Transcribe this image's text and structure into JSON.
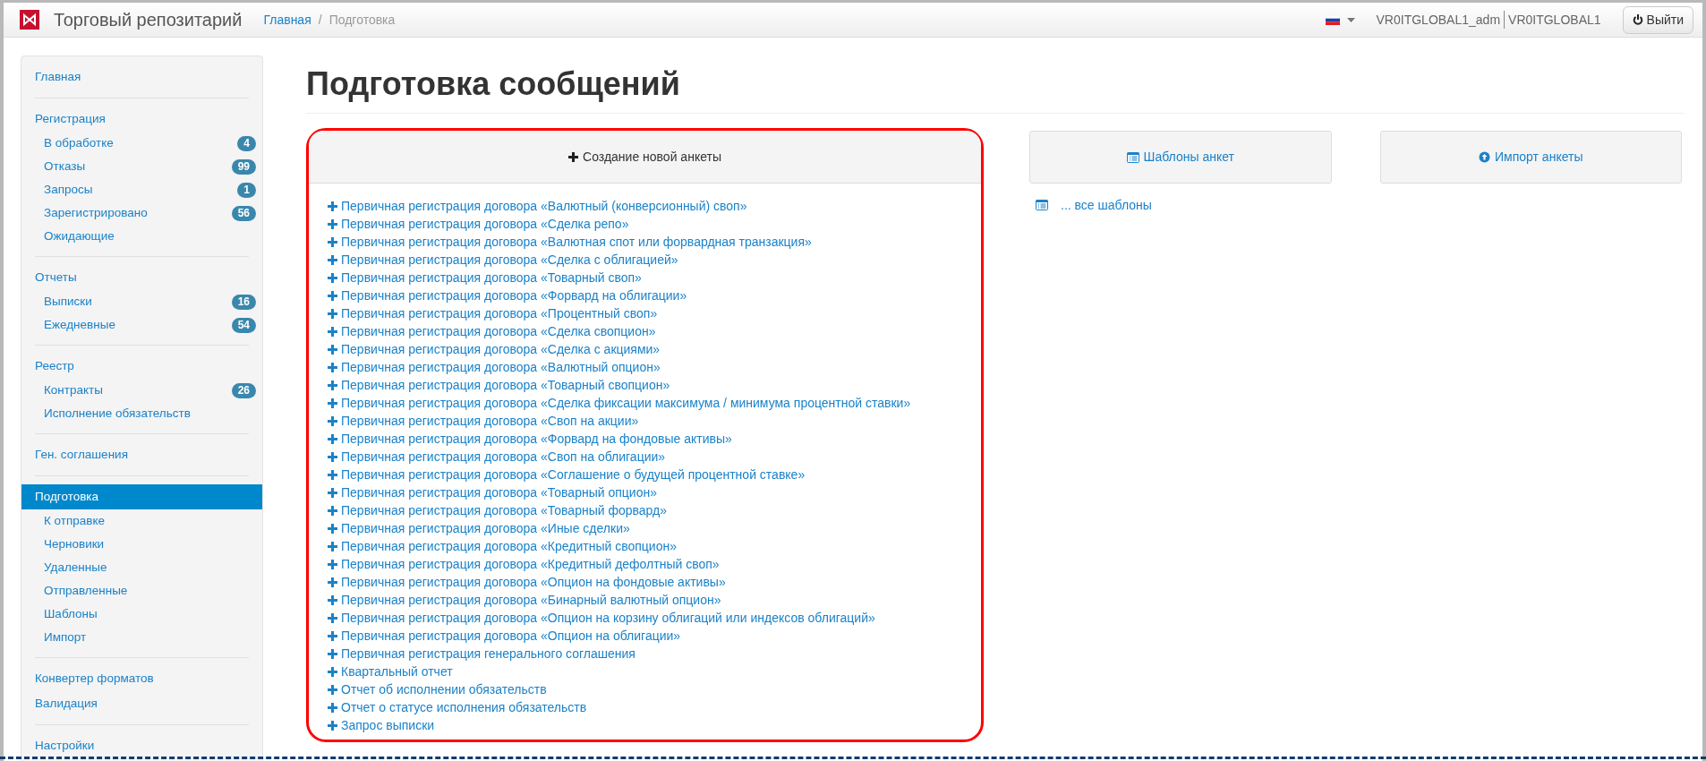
{
  "header": {
    "title": "Торговый репозитарий",
    "breadcrumb_separator": "/",
    "breadcrumb": [
      {
        "label": "Главная",
        "selected": false
      },
      {
        "label": "Подготовка",
        "selected": true
      }
    ],
    "user": "VR0ITGLOBAL1_adm",
    "organization": "VR0ITGLOBAL1",
    "logout": "Выйти"
  },
  "sidebar": {
    "groups": [
      {
        "sections": [
          {
            "label": "Главная",
            "selected": false
          }
        ]
      },
      {
        "sections": [
          {
            "label": "Регистрация",
            "selected": false,
            "children": [
              {
                "label": "В обработке",
                "badge": "4",
                "selected": false
              },
              {
                "label": "Отказы",
                "badge": "99",
                "selected": false
              },
              {
                "label": "Запросы",
                "badge": "1",
                "selected": false
              },
              {
                "label": "Зарегистрировано",
                "badge": "56",
                "selected": false
              },
              {
                "label": "Ожидающие",
                "selected": false
              }
            ]
          }
        ]
      },
      {
        "sections": [
          {
            "label": "Отчеты",
            "selected": false,
            "children": [
              {
                "label": "Выписки",
                "badge": "16",
                "selected": false
              },
              {
                "label": "Ежедневные",
                "badge": "54",
                "selected": false
              }
            ]
          }
        ]
      },
      {
        "sections": [
          {
            "label": "Реестр",
            "selected": false,
            "children": [
              {
                "label": "Контракты",
                "badge": "26",
                "selected": false
              },
              {
                "label": "Исполнение обязательств",
                "selected": false
              }
            ]
          }
        ]
      },
      {
        "sections": [
          {
            "label": "Ген. соглашения",
            "selected": false
          }
        ]
      },
      {
        "sections": [
          {
            "label": "Подготовка",
            "selected": true,
            "children": [
              {
                "label": "К отправке",
                "selected": false
              },
              {
                "label": "Черновики",
                "selected": false
              },
              {
                "label": "Удаленные",
                "selected": false
              },
              {
                "label": "Отправленные",
                "selected": false
              },
              {
                "label": "Шаблоны",
                "selected": false
              },
              {
                "label": "Импорт",
                "selected": false
              }
            ]
          }
        ]
      },
      {
        "sections": [
          {
            "label": "Конвертер форматов",
            "selected": false
          },
          {
            "label": "Валидация",
            "selected": false
          }
        ]
      },
      {
        "sections": [
          {
            "label": "Настройки",
            "selected": false
          }
        ]
      }
    ]
  },
  "page_title": "Подготовка сообщений",
  "panels": [
    {
      "kind": "create",
      "title": "Создание новой анкеты",
      "highlighted": true,
      "items": [
        "Первичная регистрация договора «Валютный (конверсионный) своп»",
        "Первичная регистрация договора «Сделка репо»",
        "Первичная регистрация договора «Валютная спот или форвардная транзакция»",
        "Первичная регистрация договора «Сделка с облигацией»",
        "Первичная регистрация договора «Товарный своп»",
        "Первичная регистрация договора «Форвард на облигации»",
        "Первичная регистрация договора «Процентный своп»",
        "Первичная регистрация договора «Сделка свопцион»",
        "Первичная регистрация договора «Сделка с акциями»",
        "Первичная регистрация договора «Валютный опцион»",
        "Первичная регистрация договора «Товарный свопцион»",
        "Первичная регистрация договора «Сделка фиксации максимума / минимума процентной ставки»",
        "Первичная регистрация договора «Своп на акции»",
        "Первичная регистрация договора «Форвард на фондовые активы»",
        "Первичная регистрация договора «Своп на облигации»",
        "Первичная регистрация договора «Соглашение о будущей процентной ставке»",
        "Первичная регистрация договора «Товарный опцион»",
        "Первичная регистрация договора «Товарный форвард»",
        "Первичная регистрация договора «Иные сделки»",
        "Первичная регистрация договора «Кредитный свопцион»",
        "Первичная регистрация договора «Кредитный дефолтный своп»",
        "Первичная регистрация договора «Опцион на фондовые активы»",
        "Первичная регистрация договора «Бинарный валютный опцион»",
        "Первичная регистрация договора «Опцион на корзину облигаций или индексов облигаций»",
        "Первичная регистрация договора «Опцион на облигации»",
        "Первичная регистрация генерального соглашения",
        "Квартальный отчет",
        "Отчет об исполнении обязательств",
        "Отчет о статусе исполнения обязательств",
        "Запрос выписки"
      ]
    },
    {
      "kind": "templates",
      "title": "Шаблоны анкет",
      "highlighted": false,
      "items": [
        "... все шаблоны"
      ]
    },
    {
      "kind": "import",
      "title": "Импорт анкеты",
      "highlighted": false
    }
  ]
}
